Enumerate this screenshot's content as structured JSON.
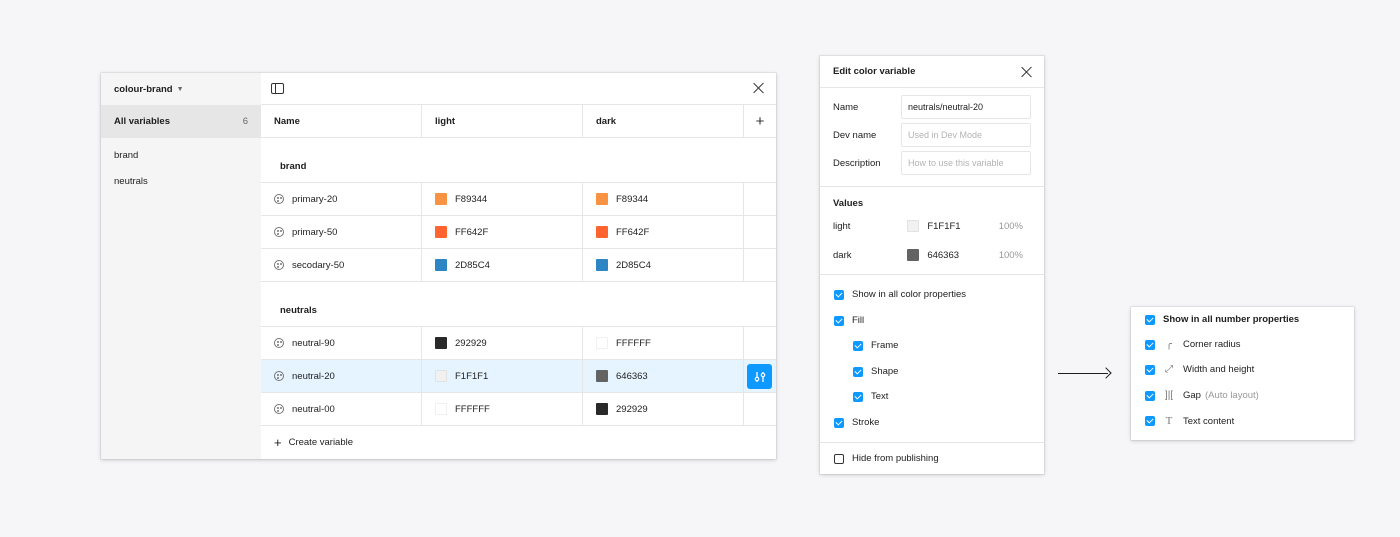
{
  "vars_window": {
    "collection_name": "colour-brand",
    "sidebar": {
      "all_label": "All variables",
      "all_count": "6",
      "groups": [
        "brand",
        "neutrals"
      ]
    },
    "columns": {
      "name": "Name",
      "mode1": "light",
      "mode2": "dark"
    },
    "groups": [
      {
        "title": "brand",
        "rows": [
          {
            "name": "primary-20",
            "light_hex": "F89344",
            "light_color": "#F89344",
            "dark_hex": "F89344",
            "dark_color": "#F89344"
          },
          {
            "name": "primary-50",
            "light_hex": "FF642F",
            "light_color": "#FF642F",
            "dark_hex": "FF642F",
            "dark_color": "#FF642F"
          },
          {
            "name": "secodary-50",
            "light_hex": "2D85C4",
            "light_color": "#2D85C4",
            "dark_hex": "2D85C4",
            "dark_color": "#2D85C4"
          }
        ]
      },
      {
        "title": "neutrals",
        "rows": [
          {
            "name": "neutral-90",
            "light_hex": "292929",
            "light_color": "#292929",
            "dark_hex": "FFFFFF",
            "dark_color": "#FFFFFF"
          },
          {
            "name": "neutral-20",
            "light_hex": "F1F1F1",
            "light_color": "#F1F1F1",
            "dark_hex": "646363",
            "dark_color": "#646363"
          },
          {
            "name": "neutral-00",
            "light_hex": "FFFFFF",
            "light_color": "#FFFFFF",
            "dark_hex": "292929",
            "dark_color": "#292929"
          }
        ]
      }
    ],
    "create_label": "Create variable"
  },
  "edit_panel": {
    "title": "Edit color variable",
    "name_label": "Name",
    "name_value": "neutrals/neutral-20",
    "dev_label": "Dev name",
    "dev_placeholder": "Used in Dev Mode",
    "desc_label": "Description",
    "desc_placeholder": "How to use this variable",
    "values_title": "Values",
    "values": [
      {
        "mode": "light",
        "hex": "F1F1F1",
        "color": "#F1F1F1",
        "opacity": "100%"
      },
      {
        "mode": "dark",
        "hex": "646363",
        "color": "#646363",
        "opacity": "100%"
      }
    ],
    "scopes": {
      "all": "Show in all color properties",
      "fill": "Fill",
      "frame": "Frame",
      "shape": "Shape",
      "text": "Text",
      "stroke": "Stroke"
    },
    "hide_label": "Hide from publishing"
  },
  "number_panel": {
    "all": "Show in all number properties",
    "corner": "Corner radius",
    "width_height": "Width and height",
    "gap": "Gap",
    "gap_suffix": "(Auto layout)",
    "text_content": "Text content"
  },
  "colors": {
    "accent": "#0D99FF",
    "selected_row": "#E5F4FF"
  }
}
